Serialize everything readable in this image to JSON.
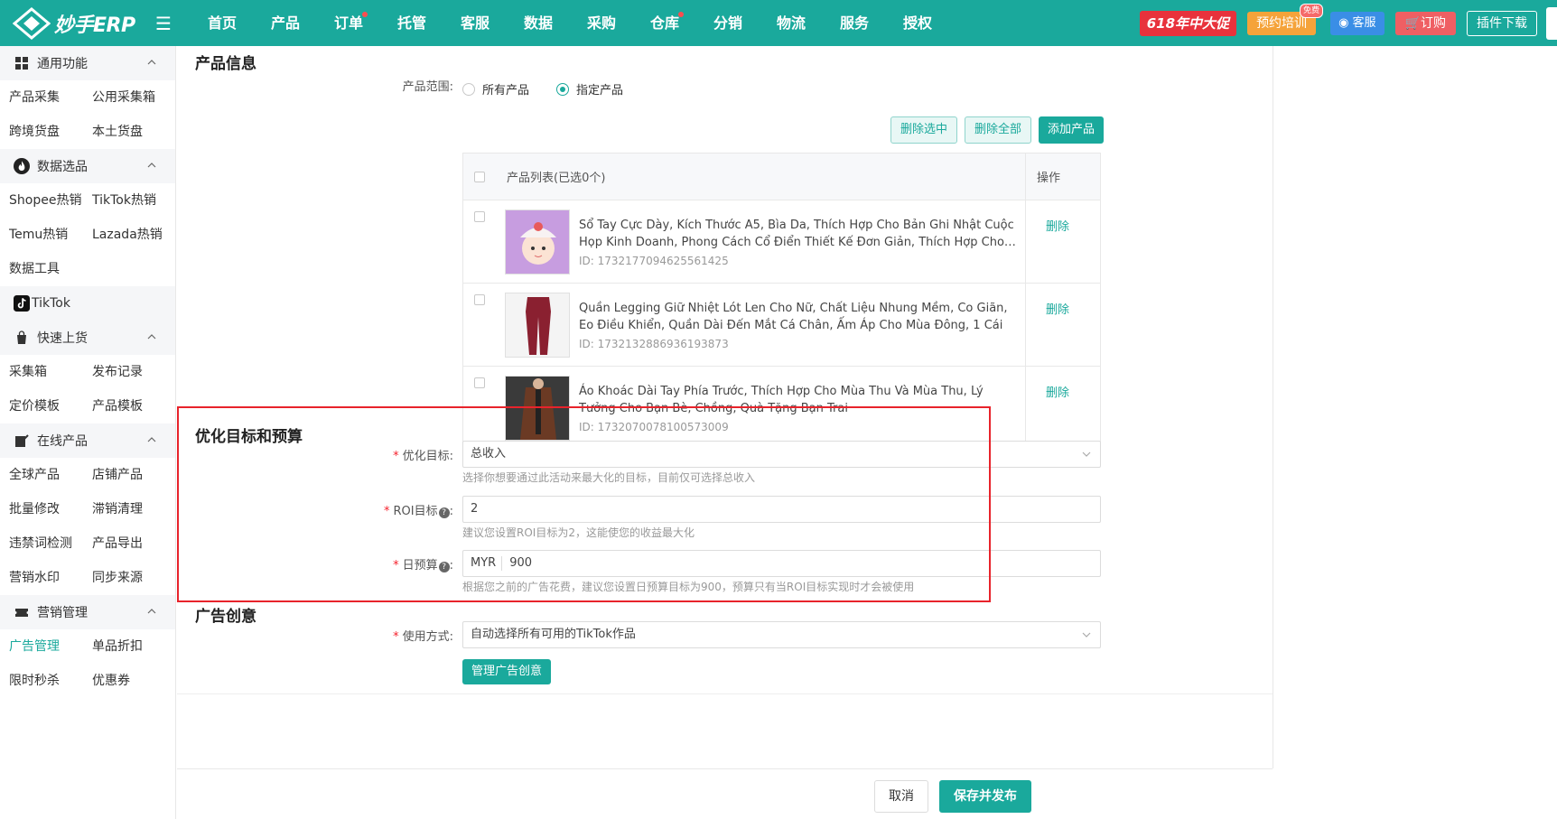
{
  "topbar": {
    "brand": "妙手ERP",
    "nav": [
      {
        "label": "首页",
        "dot": false
      },
      {
        "label": "产品",
        "dot": false
      },
      {
        "label": "订单",
        "dot": true
      },
      {
        "label": "托管",
        "dot": false
      },
      {
        "label": "客服",
        "dot": false
      },
      {
        "label": "数据",
        "dot": false
      },
      {
        "label": "采购",
        "dot": false
      },
      {
        "label": "仓库",
        "dot": true
      },
      {
        "label": "分销",
        "dot": false
      },
      {
        "label": "物流",
        "dot": false
      },
      {
        "label": "服务",
        "dot": false
      },
      {
        "label": "授权",
        "dot": false
      }
    ],
    "promo": "618年中大促",
    "training": "预约培训",
    "training_badge": "免费",
    "customer_service": "客服",
    "order": "订购",
    "plugin_download": "插件下载"
  },
  "sidebar": {
    "sections": [
      {
        "title": "通用功能",
        "icon": "grid-icon",
        "items": [
          "产品采集",
          "公用采集箱",
          "跨境货盘",
          "本土货盘"
        ]
      },
      {
        "title": "数据选品",
        "icon": "fire-icon",
        "items": [
          "Shopee热销",
          "TikTok热销",
          "Temu热销",
          "Lazada热销",
          "数据工具"
        ]
      },
      {
        "title": "快速上货",
        "icon": "bag-icon",
        "items": [
          "采集箱",
          "发布记录",
          "定价模板",
          "产品模板"
        ]
      },
      {
        "title": "在线产品",
        "icon": "edit-icon",
        "items": [
          "全球产品",
          "店铺产品",
          "批量修改",
          "滞销清理",
          "违禁词检测",
          "产品导出",
          "营销水印",
          "同步来源"
        ]
      },
      {
        "title": "营销管理",
        "icon": "ticket-icon",
        "items": [
          "广告管理",
          "单品折扣",
          "限时秒杀",
          "优惠券"
        ]
      }
    ],
    "tiktok_label": "TikTok",
    "active_item": "广告管理"
  },
  "product_info": {
    "section_title": "产品信息",
    "scope_label": "产品范围:",
    "scope_options": [
      "所有产品",
      "指定产品"
    ],
    "scope_selected": "指定产品",
    "delete_selected": "删除选中",
    "delete_all": "删除全部",
    "add_product": "添加产品",
    "table_header": "产品列表(已选0个)",
    "op_header": "操作",
    "delete_label": "删除",
    "products": [
      {
        "name": "Sổ Tay Cực Dày, Kích Thước A5, Bìa Da, Thích Hợp Cho Bản Ghi Nhật Cuộc Họp Kinh Doanh, Phong Cách Cổ Điển Thiết Kế Đơn Giản, Thích Hợp Cho Sinh Viên …",
        "id": "ID: 1732177094625561425"
      },
      {
        "name": "Quần Legging Giữ Nhiệt Lót Len Cho Nữ, Chất Liệu Nhung Mềm, Co Giãn, Eo Điều Khiển, Quần Dài Đến Mắt Cá Chân, Ấm Áp Cho Mùa Đông, 1 Cái",
        "id": "ID: 1732132886936193873"
      },
      {
        "name": "Áo Khoác Dài Tay Phía Trước, Thích Hợp Cho Mùa Thu Và Mùa Thu, Lý Tưởng Cho Bạn Bè, Chồng, Quà Tặng Bạn Trai",
        "id": "ID: 1732070078100573009"
      }
    ]
  },
  "budget": {
    "section_title": "优化目标和预算",
    "goal_label": "优化目标:",
    "goal_value": "总收入",
    "goal_hint": "选择你想要通过此活动来最大化的目标，目前仅可选择总收入",
    "roi_label": "ROI目标",
    "roi_value": "2",
    "roi_hint": "建议您设置ROI目标为2，这能使您的收益最大化",
    "daily_label": "日预算",
    "currency": "MYR",
    "daily_value": "900",
    "daily_hint": "根据您之前的广告花费，建议您设置日预算目标为900，预算只有当ROI目标实现时才会被使用"
  },
  "creative": {
    "section_title": "广告创意",
    "usage_label": "使用方式:",
    "usage_value": "自动选择所有可用的TikTok作品",
    "manage_button": "管理广告创意"
  },
  "footer": {
    "cancel": "取消",
    "publish": "保存并发布"
  },
  "colors": {
    "primary": "#1aa99c",
    "highlight_frame": "#e8232b"
  }
}
